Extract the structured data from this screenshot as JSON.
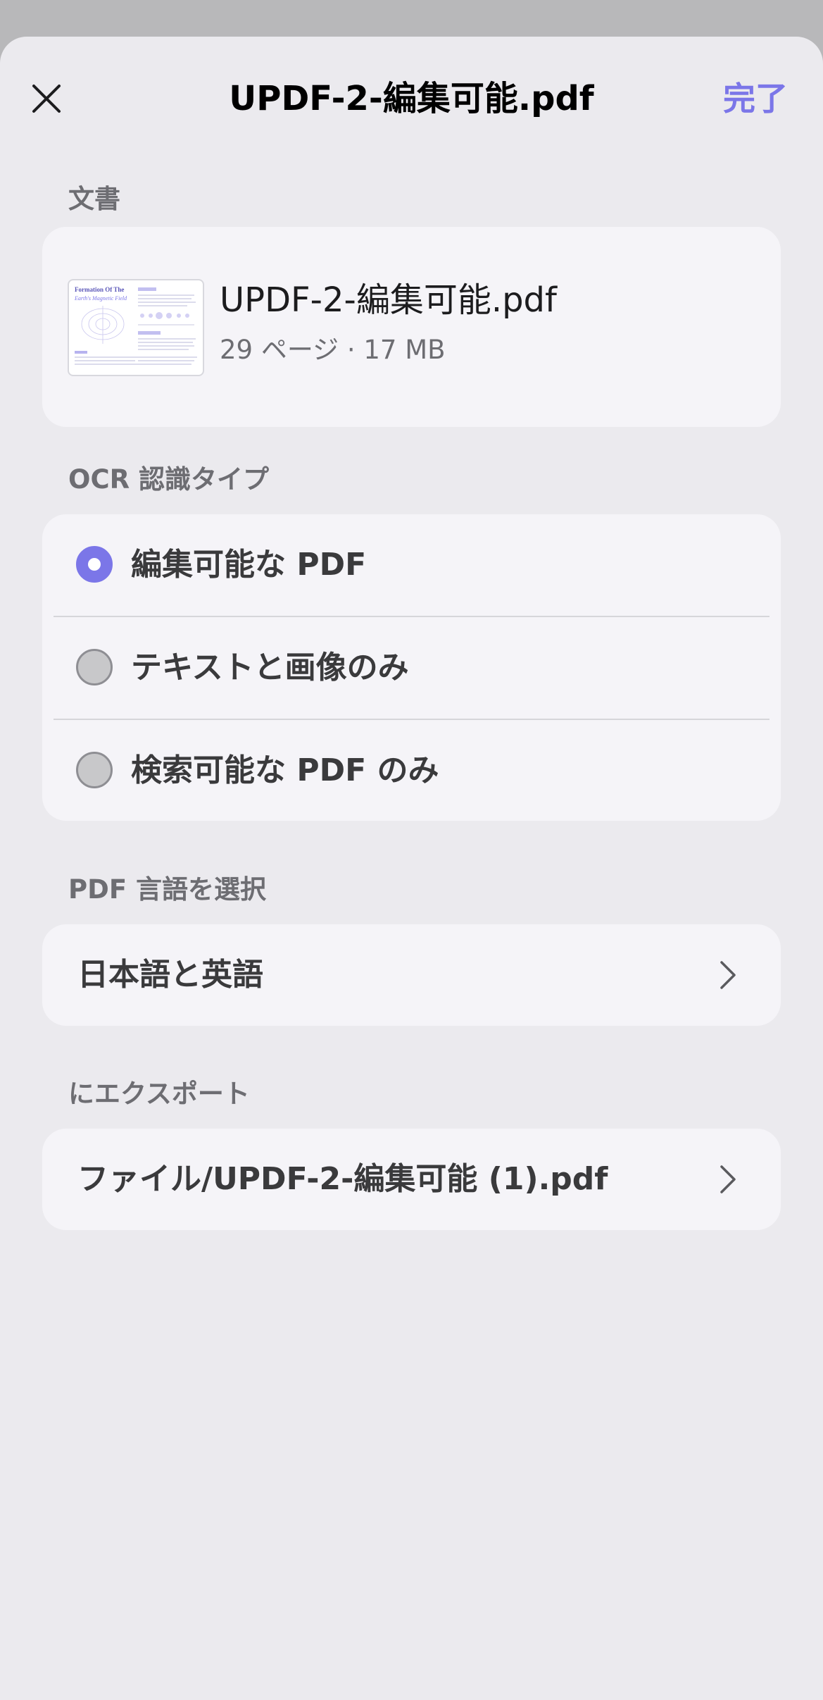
{
  "header": {
    "title": "UPDF-2-編集可能.pdf",
    "done_label": "完了",
    "close_icon": "close-icon"
  },
  "document_section": {
    "label": "文書",
    "file_name": "UPDF-2-編集可能.pdf",
    "meta": "29 ページ · 17 MB",
    "thumbnail": {
      "heading_line1": "Formation Of The",
      "heading_line2": "Earth's Magnetic Field"
    }
  },
  "ocr_section": {
    "label": "OCR 認識タイプ",
    "options": [
      {
        "label": "編集可能な PDF",
        "selected": true
      },
      {
        "label": "テキストと画像のみ",
        "selected": false
      },
      {
        "label": "検索可能な PDF のみ",
        "selected": false
      }
    ]
  },
  "language_section": {
    "label": "PDF 言語を選択",
    "value": "日本語と英語"
  },
  "export_section": {
    "label": "にエクスポート",
    "value": "ファイル/UPDF-2-編集可能 (1).pdf"
  },
  "colors": {
    "accent": "#7b76e8",
    "sheet_background": "#ebeaee",
    "card_background": "#f5f4f8"
  }
}
